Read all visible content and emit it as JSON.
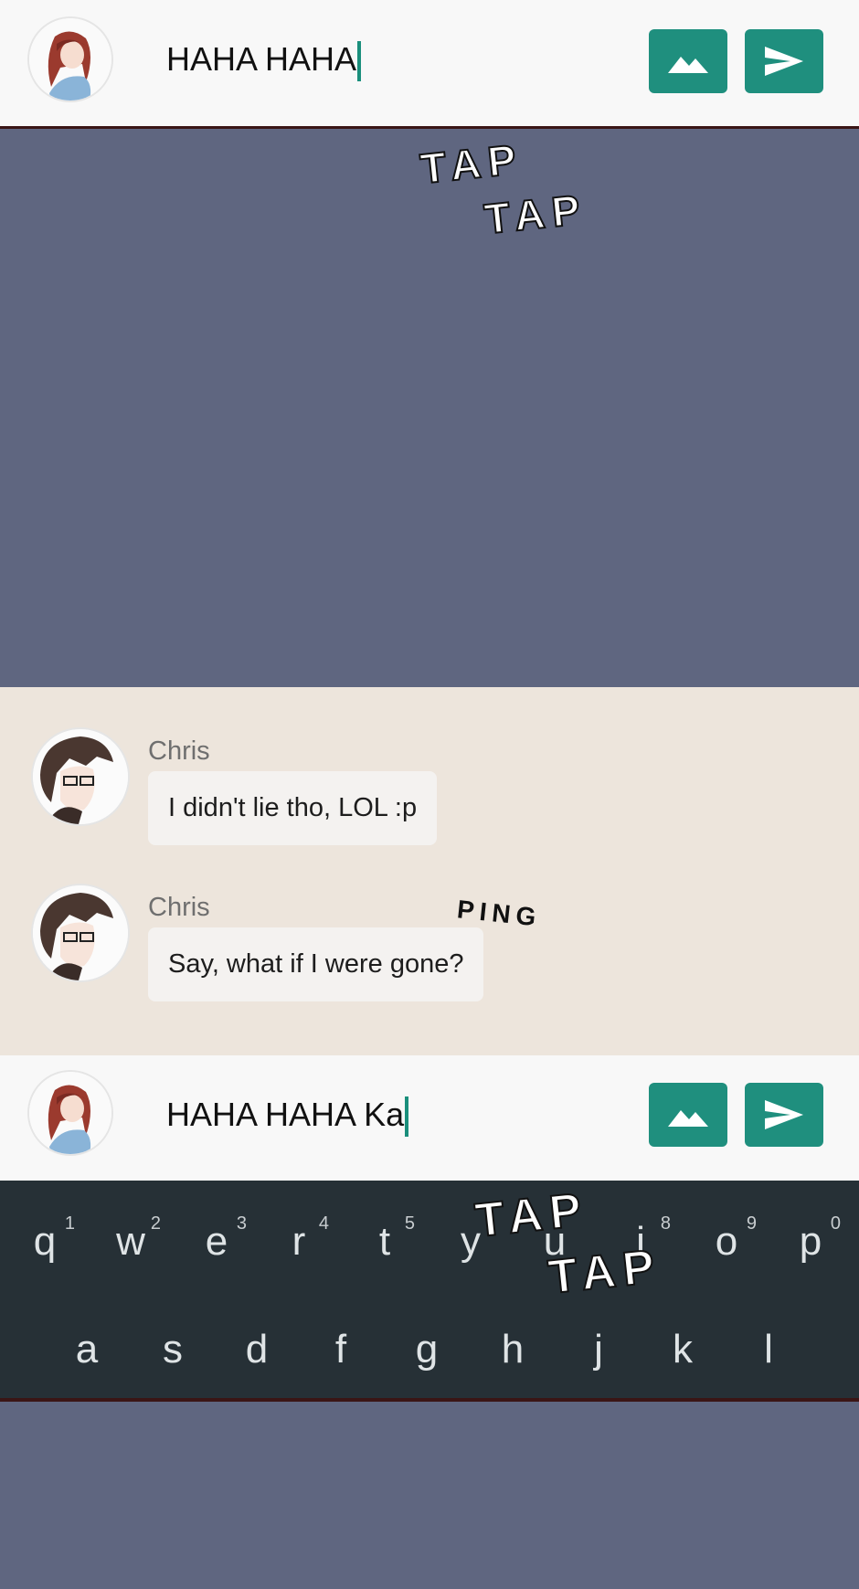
{
  "top_composer": {
    "input_text": "HAHA HAHA",
    "image_button_icon": "image-icon",
    "send_button_icon": "send-icon"
  },
  "sound_effects": {
    "tap_top_1": "TAP",
    "tap_top_2": "TAP",
    "ping": "PING",
    "tap_kb_1": "TAP",
    "tap_kb_2": "TAP"
  },
  "chat": {
    "messages": [
      {
        "sender": "Chris",
        "text": "I didn't lie tho, LOL :p"
      },
      {
        "sender": "Chris",
        "text": "Say, what if I were gone?"
      }
    ]
  },
  "bottom_composer": {
    "input_text": "HAHA HAHA Ka",
    "image_button_icon": "image-icon",
    "send_button_icon": "send-icon"
  },
  "keyboard": {
    "row1": [
      {
        "key": "q",
        "hint": "1"
      },
      {
        "key": "w",
        "hint": "2"
      },
      {
        "key": "e",
        "hint": "3"
      },
      {
        "key": "r",
        "hint": "4"
      },
      {
        "key": "t",
        "hint": "5"
      },
      {
        "key": "y",
        "hint": ""
      },
      {
        "key": "u",
        "hint": ""
      },
      {
        "key": "i",
        "hint": "8"
      },
      {
        "key": "o",
        "hint": "9"
      },
      {
        "key": "p",
        "hint": "0"
      }
    ],
    "row2": [
      "a",
      "s",
      "d",
      "f",
      "g",
      "h",
      "j",
      "k",
      "l"
    ]
  },
  "colors": {
    "background": "#5f6680",
    "accent": "#1f8f7e",
    "chat_bg": "#ede5dc",
    "keyboard_bg": "#263036"
  }
}
